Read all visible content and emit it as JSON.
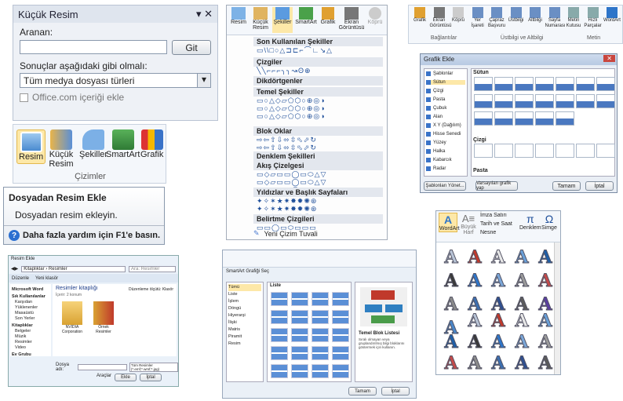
{
  "clip_pane": {
    "title": "Küçük Resim",
    "search_label": "Aranan:",
    "search_value": "",
    "go_button": "Git",
    "results_label": "Sonuçlar aşağıdaki gibi olmalı:",
    "media_type": "Tüm medya dosyası türleri",
    "office_checkbox": "Office.com içeriği ekle"
  },
  "ribbon": {
    "buttons": [
      "Resim",
      "Küçük Resim",
      "Şekiller",
      "SmartArt",
      "Grafik"
    ],
    "group": "Çizimler"
  },
  "tooltip": {
    "title": "Dosyadan Resim Ekle",
    "desc": "Dosyadan resim ekleyin.",
    "help": "Daha fazla yardım için F1'e basın."
  },
  "top_ribbon": {
    "buttons": [
      "Resim",
      "Küçük Resim",
      "Şekiller",
      "SmartArt",
      "Grafik",
      "Ekran Görüntüsü",
      "Köprü"
    ]
  },
  "shapes_menu": {
    "sections": [
      "Son Kullanılan Şekiller",
      "Çizgiler",
      "Dikdörtgenler",
      "Temel Şekiller",
      "Blok Oklar",
      "Denklem Şekilleri",
      "Akış Çizelgesi",
      "Yıldızlar ve Başlık Sayfaları",
      "Belirtme Çizgileri"
    ],
    "footer": "Yeni Çizim Tuvali"
  },
  "chart_ribbon": {
    "buttons": [
      "Grafik",
      "Ekran Görüntüsü",
      "Köprü",
      "Yer İşareti",
      "Çapraz Başvuru",
      "Üstbilgi",
      "Altbilgi",
      "Sayfa Numarası",
      "Metin Kutusu",
      "Hızlı Parçalar",
      "WordArt"
    ],
    "groups": [
      "Bağlantılar",
      "Üstbilgi ve Altbilgi",
      "Metin"
    ]
  },
  "chart_dialog": {
    "title": "Grafik Ekle",
    "categories": [
      "Şablonlar",
      "Sütun",
      "Çizgi",
      "Pasta",
      "Çubuk",
      "Alan",
      "X Y (Dağılım)",
      "Hisse Senedi",
      "Yüzey",
      "Halka",
      "Kabarcık",
      "Radar"
    ],
    "sec1": "Sütun",
    "sec2": "Çizgi",
    "sec3": "Pasta",
    "manage": "Şablonları Yönet...",
    "default": "Varsayılan grafik yap",
    "ok": "Tamam",
    "cancel": "İptal"
  },
  "explorer": {
    "title": "Resim Ekle",
    "path": "Kitaplıklar › Resimler",
    "search": "Ara: Resimler",
    "organize": "Düzenle",
    "new_folder": "Yeni klasör",
    "library_title": "Resimler kitaplığı",
    "library_sub": "İçerir: 2 konum",
    "arrange": "Düzenleme ölçütü: Klasör",
    "nav": [
      "Microsoft Word",
      "Sık Kullanılanlar",
      "Karşıdan Yüklenenler",
      "Masaüstü",
      "Son Yerler",
      "Kitaplıklar",
      "Belgeler",
      "Müzik",
      "Resimler",
      "Video",
      "Ev Grubu"
    ],
    "folders": [
      "NVIDIA Corporation",
      "Örnek Resimler"
    ],
    "filename_label": "Dosya adı:",
    "filter": "Tüm Resimler (*.emf;*.wmf;*.jpg)",
    "tools": "Araçlar",
    "insert": "Ekle",
    "cancel": "İptal"
  },
  "smartart": {
    "title": "SmartArt Grafiği Seç",
    "categories": [
      "Tümü",
      "Liste",
      "İşlem",
      "Döngü",
      "Hiyerarşi",
      "İlişki",
      "Matris",
      "Piramit",
      "Resim"
    ],
    "list_title": "Liste",
    "preview_title": "Temel Blok Listesi",
    "preview_desc": "Sıralı olmayan veya gruplandırılmış bilgi bloklarını göstermek için kullanın.",
    "ok": "Tamam",
    "cancel": "İptal"
  },
  "wordart": {
    "buttons": [
      "WordArt",
      "Büyük Harf",
      "İmza Satırı",
      "Tarih ve Saat",
      "Nesne",
      "Denklem",
      "Simge"
    ],
    "letter": "A",
    "colors": [
      "#b8c4d6",
      "#c0392b",
      "#e8e8e8",
      "#6aa0d8",
      "#1f5fa8",
      "#3a3a3a",
      "#2e75c9",
      "#7aa6d8",
      "#9a9a9a",
      "#c44a4a",
      "#8a8a8a",
      "#3c6fb0",
      "#2f4f8f",
      "#5b5b5b",
      "#5b3fa0",
      "#4a86c8"
    ]
  }
}
